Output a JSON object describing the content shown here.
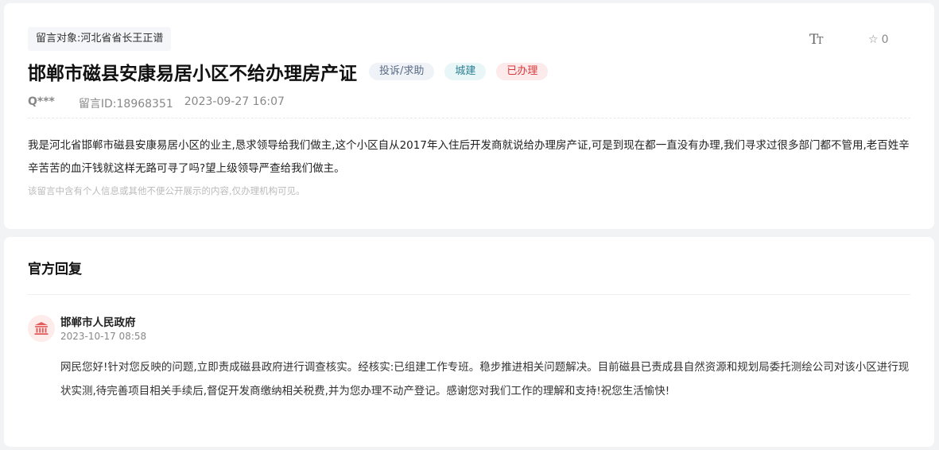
{
  "message": {
    "target_label": "留言对象:河北省省长王正谱",
    "toolbar": {
      "font_big": "T",
      "font_small": "T",
      "fav_count": "0"
    },
    "title": "邯郸市磁县安康易居小区不给办理房产证",
    "tags": {
      "type": "投诉/求助",
      "category": "城建",
      "status": "已办理"
    },
    "user": "Q***",
    "message_id": "留言ID:18968351",
    "datetime": "2023-09-27 16:07",
    "content": "我是河北省邯郸市磁县安康易居小区的业主,恳求领导给我们做主,这个小区自从2017年入住后开发商就说给办理房产证,可是到现在都一直没有办理,我们寻求过很多部门都不管用,老百姓辛辛苦苦的血汗钱就这样无路可寻了吗?望上级领导严查给我们做主。",
    "privacy_notice": "该留言中含有个人信息或其他不便公开展示的内容,仅办理机构可见。"
  },
  "reply": {
    "section_title": "官方回复",
    "replier": "邯郸市人民政府",
    "datetime": "2023-10-17 08:58",
    "content": "网民您好!针对您反映的问题,立即责成磁县政府进行调查核实。经核实:已组建工作专班。稳步推进相关问题解决。目前磁县已责成县自然资源和规划局委托测绘公司对该小区进行现状实测,待完善项目相关手续后,督促开发商缴纳相关税费,并为您办理不动产登记。感谢您对我们工作的理解和支持!祝您生活愉快!"
  },
  "colors": {
    "status_red": "#d8373c",
    "category_teal": "#2c7f95",
    "avatar_bg": "#fdecea",
    "avatar_icon": "#e35d5d"
  },
  "icons": {
    "font_size": "font-size-icon",
    "favorite": "star-outline-icon",
    "replier_avatar": "government-building-icon"
  }
}
